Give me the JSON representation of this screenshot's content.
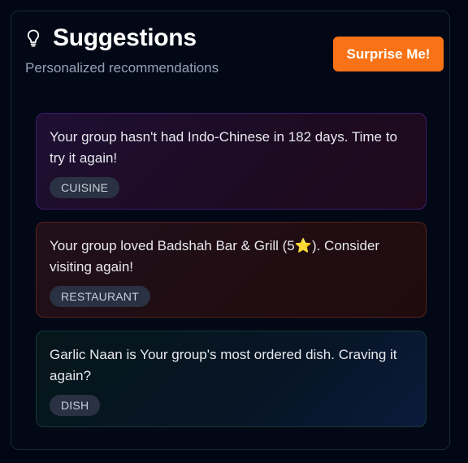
{
  "header": {
    "icon": "lightbulb-icon",
    "title": "Suggestions",
    "subtitle": "Personalized recommendations",
    "surprise_label": "Surprise Me!"
  },
  "suggestions": [
    {
      "text": "Your group hasn't had Indo-Chinese in 182 days. Time to try it again!",
      "tag": "CUISINE"
    },
    {
      "text_before": "Your group loved Badshah Bar & Grill (5",
      "star": "⭐",
      "text_after": "). Consider visiting again!",
      "tag": "RESTAURANT"
    },
    {
      "text": "Garlic Naan is Your group's most ordered dish. Craving it again?",
      "tag": "DISH"
    }
  ],
  "colors": {
    "accent": "#f97316",
    "background": "#010614",
    "card_cuisine_border": "#3e1c6b",
    "card_restaurant_border": "#5a2316",
    "card_dish_border": "#163a32"
  }
}
